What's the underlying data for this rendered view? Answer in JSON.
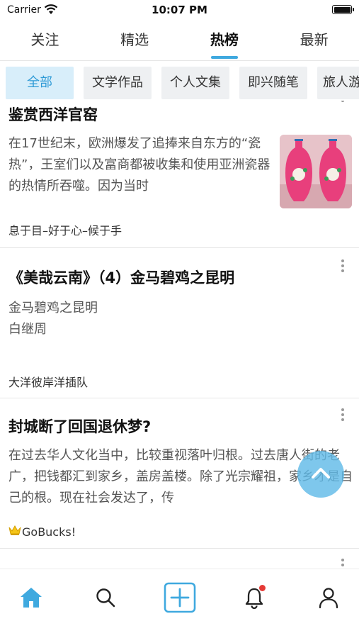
{
  "status_bar": {
    "carrier": "Carrier",
    "time": "10:07 PM"
  },
  "top_tabs": [
    {
      "label": "关注",
      "active": false
    },
    {
      "label": "精选",
      "active": false
    },
    {
      "label": "热榜",
      "active": true
    },
    {
      "label": "最新",
      "active": false
    }
  ],
  "categories": [
    {
      "label": "全部",
      "active": true
    },
    {
      "label": "文学作品",
      "active": false
    },
    {
      "label": "个人文集",
      "active": false
    },
    {
      "label": "即兴随笔",
      "active": false
    },
    {
      "label": "旅人游",
      "active": false
    }
  ],
  "feed": [
    {
      "title": "鉴赏西洋官窑",
      "excerpt": "在17世纪末，欧洲爆发了追捧来自东方的“瓷热”，王室们以及富商都被收集和使用亚洲瓷器的热情所吞噬。因为当时",
      "author": "息于目–好于心–候于手",
      "has_thumbnail": true
    },
    {
      "title": "《美哉云南》（4）金马碧鸡之昆明",
      "excerpt_lines": [
        "金马碧鸡之昆明",
        "白继周"
      ],
      "author": "大洋彼岸洋插队",
      "has_thumbnail": false
    },
    {
      "title": "封城断了回国退休梦?",
      "excerpt": "在过去华人文化当中，比较重视落叶归根。过去唐人街的老广，把钱都汇到家乡，盖房盖楼。除了光宗耀祖，家乡才是自己的根。现在社会发达了，传",
      "author": "GoBucks!",
      "has_thumbnail": false
    }
  ],
  "bottom_nav": [
    {
      "icon": "home-icon",
      "active": true
    },
    {
      "icon": "search-icon",
      "active": false
    },
    {
      "icon": "add-icon",
      "active": false
    },
    {
      "icon": "bell-icon",
      "active": false,
      "badge": true
    },
    {
      "icon": "user-icon",
      "active": false
    }
  ],
  "colors": {
    "accent": "#3fa9df",
    "chip_active_bg": "#d8eefa",
    "chip_bg": "#eef0f2",
    "badge": "#e53935"
  }
}
